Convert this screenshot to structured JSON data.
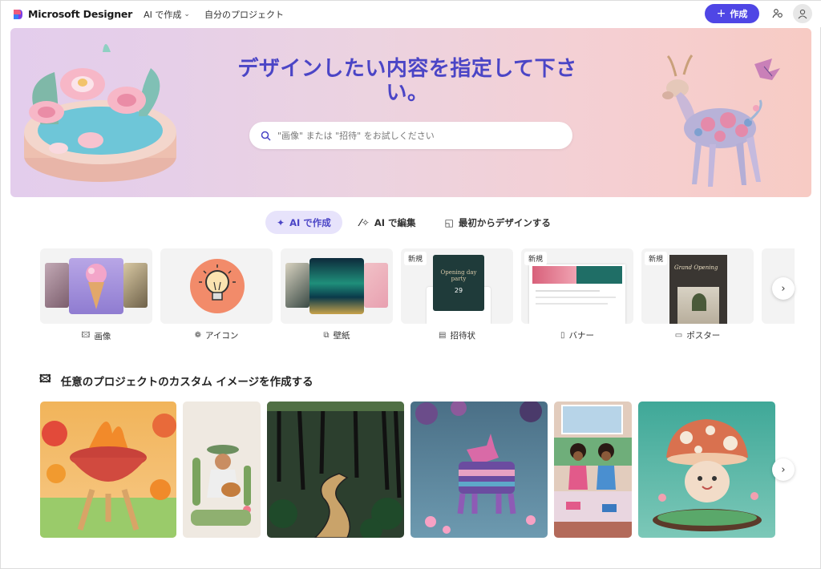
{
  "header": {
    "brand": "Microsoft Designer",
    "nav": [
      {
        "label": "AI で作成",
        "has_dropdown": true
      },
      {
        "label": "自分のプロジェクト",
        "has_dropdown": false
      }
    ],
    "create_label": "作成",
    "accent": "#4f46e5"
  },
  "hero": {
    "title": "デザインしたい内容を指定して下さい。",
    "search_placeholder": "\"画像\" または \"招待\" をお試しください"
  },
  "tabs": [
    {
      "label": "AI で作成",
      "active": true,
      "icon": "sparkle-icon"
    },
    {
      "label": "AI で編集",
      "active": false,
      "icon": "magic-wand-icon"
    },
    {
      "label": "最初からデザインする",
      "active": false,
      "icon": "shapes-icon"
    }
  ],
  "templates": [
    {
      "label": "画像",
      "icon": "image-sparkle-icon",
      "new": false
    },
    {
      "label": "アイコン",
      "icon": "icon-sparkle-icon",
      "new": false
    },
    {
      "label": "壁紙",
      "icon": "wallpaper-icon",
      "new": false
    },
    {
      "label": "招待状",
      "icon": "invitation-icon",
      "new": true,
      "badge": "新規"
    },
    {
      "label": "バナー",
      "icon": "banner-icon",
      "new": true,
      "badge": "新規"
    },
    {
      "label": "ポスター",
      "icon": "poster-icon",
      "new": true,
      "badge": "新規"
    }
  ],
  "invite_card_text": {
    "title": "Opening day party",
    "date": "29"
  },
  "poster_card_text": {
    "title": "Grand Opening"
  },
  "custom_section": {
    "title": "任意のプロジェクトのカスタム イメージを作成する"
  },
  "gallery": [
    {
      "name": "bbq-grill-image"
    },
    {
      "name": "cactus-guitarist-image"
    },
    {
      "name": "forest-path-image"
    },
    {
      "name": "pinata-party-image"
    },
    {
      "name": "girls-reading-image"
    },
    {
      "name": "mushroom-character-image"
    }
  ]
}
